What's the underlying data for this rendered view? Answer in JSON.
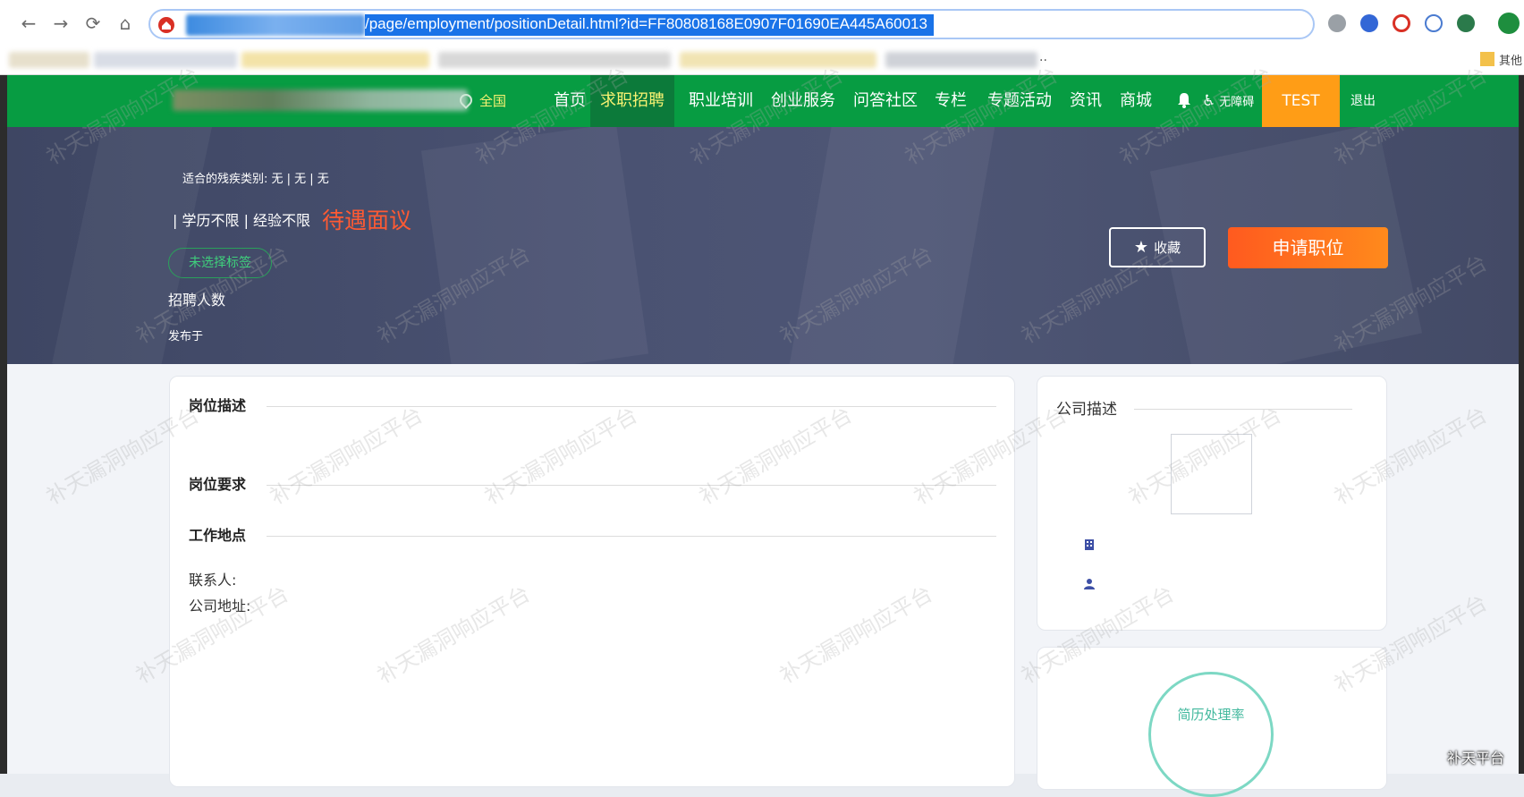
{
  "browser": {
    "url_visible": "/page/employment/positionDetail.html?id=FF80808168E0907F01690EA445A60013",
    "bookmark_tail": "..",
    "bookmark_right": "其他"
  },
  "header": {
    "location": "全国",
    "nav": [
      "首页",
      "求职招聘",
      "职业培训",
      "创业服务",
      "问答社区",
      "专栏",
      "专题活动",
      "资讯",
      "商城"
    ],
    "active_nav": "求职招聘",
    "accessibility": "无障碍",
    "user": "TEST",
    "logout": "退出"
  },
  "job": {
    "disability_types": "适合的残疾类别: 无 | 无 | 无",
    "requirements": "| 学历不限 | 经验不限",
    "salary": "待遇面议",
    "tag": "未选择标签",
    "headcount_label": "招聘人数",
    "published_label": "发布于",
    "favorite_label": "收藏",
    "apply_label": "申请职位"
  },
  "sections": {
    "description": "岗位描述",
    "requirement": "岗位要求",
    "location": "工作地点",
    "contact_label": "联系人:",
    "address_label": "公司地址:"
  },
  "company": {
    "title": "公司描述",
    "resume_rate": "简历处理率"
  },
  "watermark": {
    "text": "补天漏洞响应平台",
    "corner": "补天平台"
  }
}
